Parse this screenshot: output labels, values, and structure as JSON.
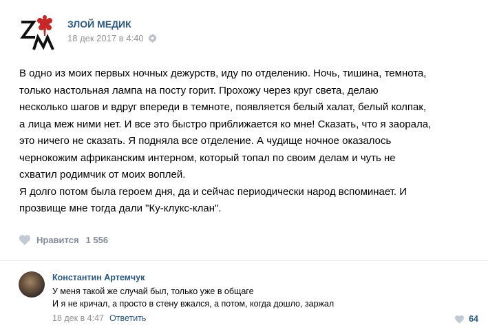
{
  "post": {
    "author": "ЗЛОЙ МЕДИК",
    "date": "18 дек 2017 в 4:40",
    "text_lines": [
      "В одно из моих первых ночных дежурств, иду по отделению. Ночь, тишина, темнота,",
      "только настольная лампа на посту горит. Прохожу через круг света, делаю",
      "несколько шагов и вдруг впереди в темноте, появляется белый халат, белый колпак,",
      "а лица меж ними нет. И все это быстро приближается ко мне! Сказать, что я заорала,",
      "это ничего не сказать. Я подняла все отделение. А чудище ночное оказалось",
      "чернокожим африканским интерном, который топал по своим делам и чуть не",
      "схватил родимчик от моих воплей.",
      "Я долго потом была героем дня, да и сейчас периодически народ вспоминает. И",
      "прозвище мне тогда дали \"Ку-клукс-клан\"."
    ],
    "likes_label": "Нравится",
    "likes_count": "1 556"
  },
  "comment": {
    "author": "Константин Артемчук",
    "lines": [
      "У меня такой же случай был, только уже в общаге",
      "И я не кричал, а просто в стену вжался, а потом, когда дошло, заржал"
    ],
    "date": "18 дек в 4:47",
    "reply_label": "Ответить",
    "likes_count": "64"
  },
  "colors": {
    "link": "#2a5885",
    "meta": "#939393",
    "heart": "#c3cad3",
    "divider": "#e7e8ec",
    "logo_red": "#c62828"
  },
  "icons": {
    "logo": "zm-logo",
    "settings": "gear-icon",
    "like": "heart-icon"
  }
}
